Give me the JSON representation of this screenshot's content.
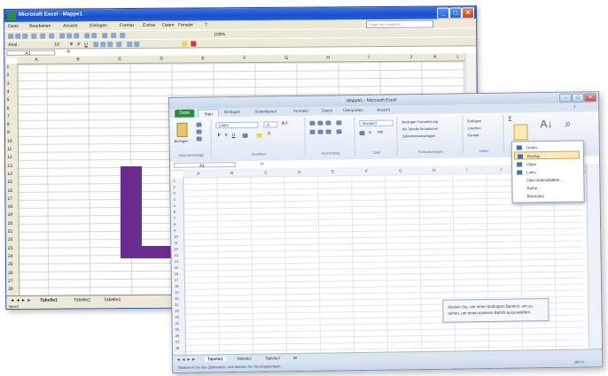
{
  "old_window": {
    "title": "Microsoft Excel - Mappe1",
    "menu": [
      "Datei",
      "Bearbeiten",
      "Ansicht",
      "Einfügen",
      "Format",
      "Extras",
      "Daten",
      "Fenster",
      "?"
    ],
    "help_placeholder": "Frage hier eingeben",
    "zoom": "100%",
    "font": "Arial",
    "font_size": "10",
    "name_box": "A1",
    "fx": "fx",
    "columns": [
      "A",
      "B",
      "C",
      "D",
      "E",
      "F",
      "G",
      "H",
      "I",
      "J",
      "K",
      "L"
    ],
    "rows": [
      "1",
      "2",
      "3",
      "4",
      "5",
      "6",
      "7",
      "8",
      "9",
      "10",
      "11",
      "12",
      "13",
      "14",
      "15",
      "16",
      "17",
      "18",
      "19",
      "20",
      "21",
      "22",
      "23",
      "24",
      "25",
      "26",
      "27",
      "28"
    ],
    "sheet_tabs": [
      "Tabelle1",
      "Tabelle2",
      "Tabelle3"
    ],
    "status": "Bereit"
  },
  "new_window": {
    "title": "Mappe1 - Microsoft Excel",
    "file_tab": "Datei",
    "ribbon_tabs": [
      "Start",
      "Einfügen",
      "Seitenlayout",
      "Formeln",
      "Daten",
      "Überprüfen",
      "Ansicht"
    ],
    "clipboard": {
      "paste": "Einfügen",
      "group": "Zwischenablage"
    },
    "font_group": {
      "font": "Calibri",
      "size": "11",
      "group": "Schriftart"
    },
    "align_group": "Ausrichtung",
    "number_group": {
      "format": "Standard",
      "group": "Zahl"
    },
    "styles_group": {
      "items": [
        "Bedingte Formatierung",
        "Als Tabelle formatieren",
        "Zellenformatvorlagen"
      ],
      "group": "Formatvorlagen"
    },
    "cells_group": {
      "items": [
        "Einfügen",
        "Löschen",
        "Format"
      ],
      "group": "Zellen"
    },
    "name_box": "A1",
    "fx": "fx",
    "columns": [
      "A",
      "B",
      "C",
      "D",
      "E",
      "F",
      "G",
      "H",
      "I",
      "J",
      "K"
    ],
    "rows": [
      "1",
      "2",
      "3",
      "4",
      "5",
      "6",
      "7",
      "8",
      "9",
      "10",
      "11",
      "12",
      "13",
      "14",
      "15",
      "16",
      "17",
      "18",
      "19",
      "20",
      "21",
      "22",
      "23",
      "24",
      "25",
      "26",
      "27",
      "28"
    ],
    "sheet_tabs": [
      "Tabelle1",
      "Tabelle2",
      "Tabelle3"
    ],
    "status": "Markieren Sie den Zielbereich, und drücken Sie die Eingabetaste.",
    "zoom": "100 %",
    "dropdown": [
      "Unten",
      "Rechts",
      "Oben",
      "Links",
      "Über Arbeitsblätter...",
      "Reihe...",
      "Blocksatz"
    ],
    "tooltip": "Klicken Sie, um einen bedingten Bereich, um zu sehen, um einen anderen Befehl auszuwählen."
  },
  "colors": {
    "arrow": "#6b2c8f",
    "xp_title": "#1a4fc9",
    "excel_green": "#2a8c3a",
    "highlight": "#fde9b8"
  }
}
